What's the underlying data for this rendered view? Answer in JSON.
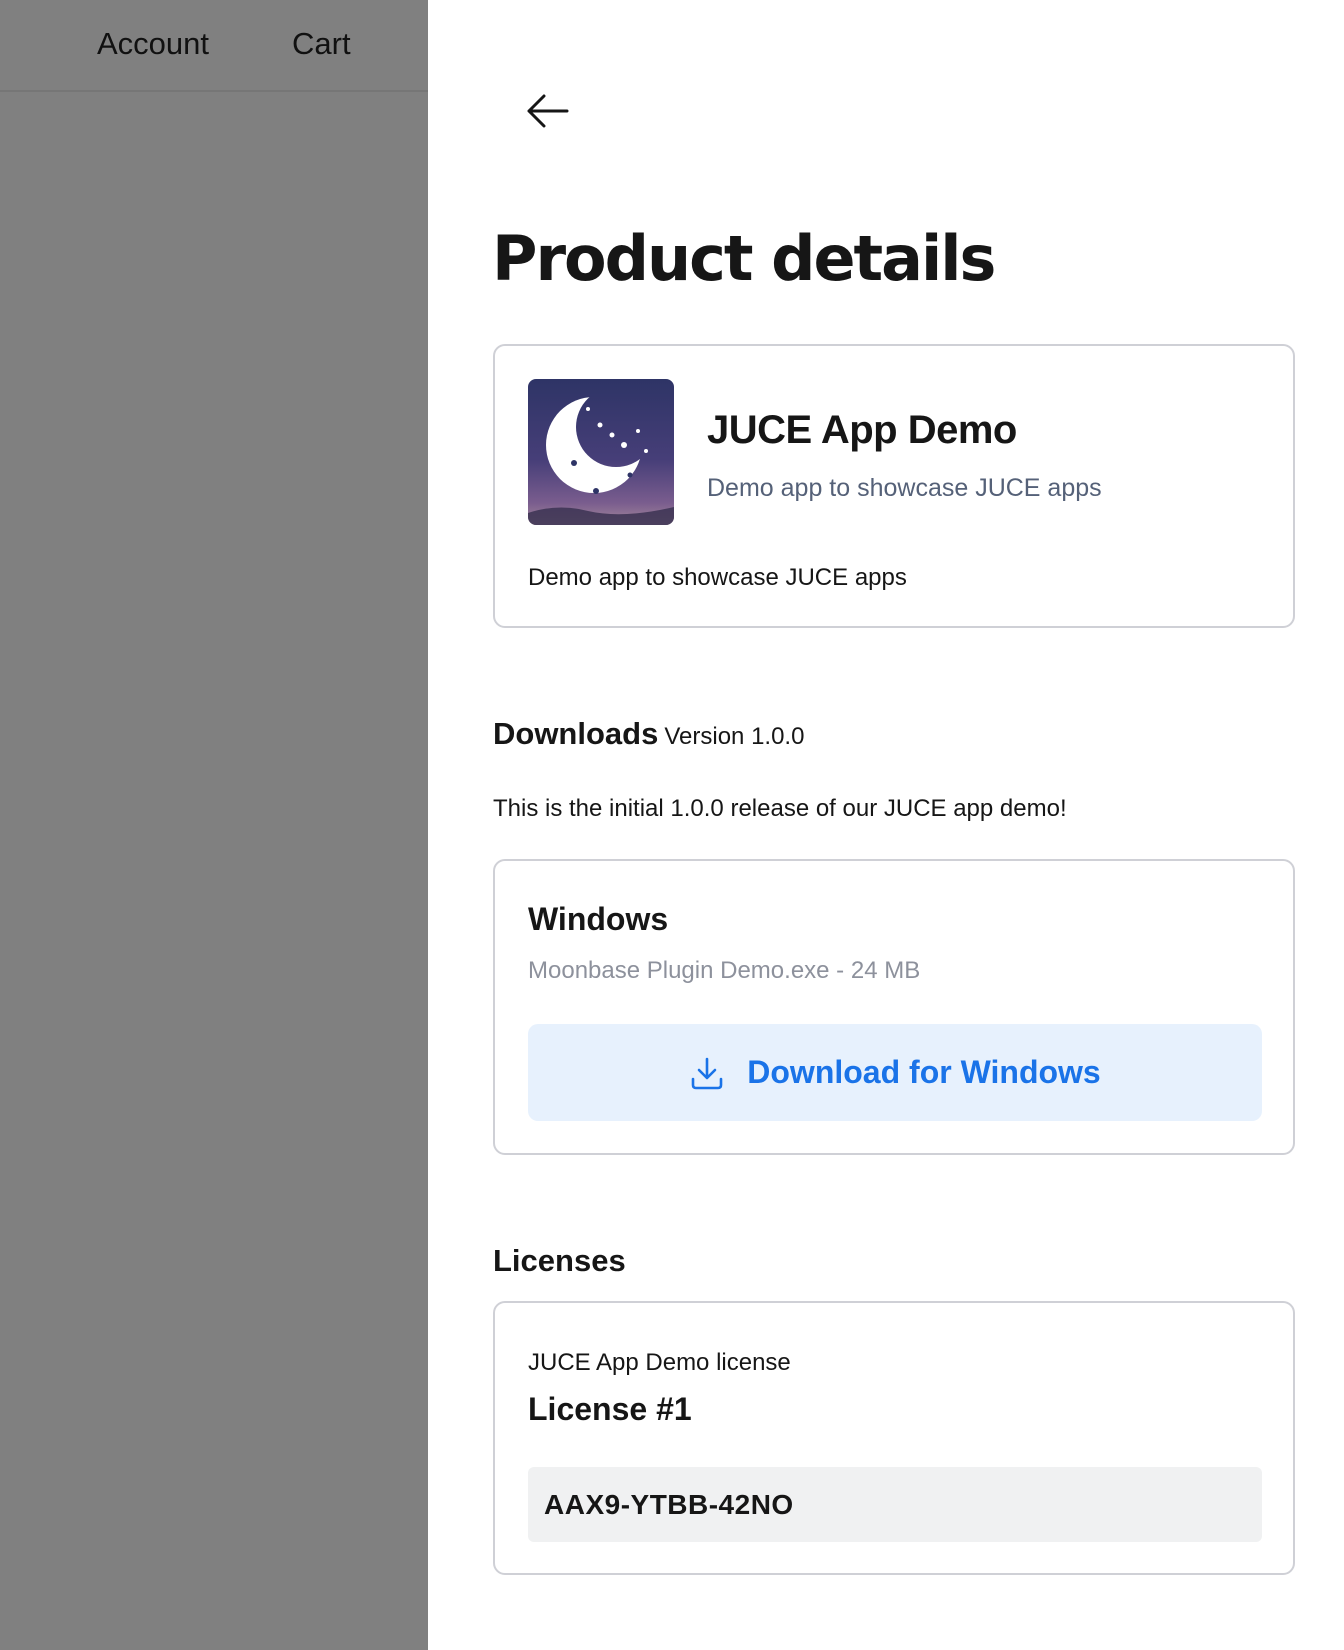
{
  "nav": {
    "account": "Account",
    "cart": "Cart"
  },
  "drawer": {
    "title": "Product details",
    "back_icon": "arrow-left-icon"
  },
  "product": {
    "icon": "crescent-moon-app-icon",
    "name": "JUCE App Demo",
    "tagline": "Demo app to showcase JUCE apps",
    "description": "Demo app to showcase JUCE apps"
  },
  "downloads": {
    "heading": "Downloads",
    "version": "Version 1.0.0",
    "release_note": "This is the initial 1.0.0 release of our JUCE app demo!",
    "items": [
      {
        "platform": "Windows",
        "file_info": "Moonbase Plugin Demo.exe - 24 MB",
        "button_label": "Download for Windows",
        "button_icon": "download-icon"
      }
    ]
  },
  "licenses": {
    "heading": "Licenses",
    "items": [
      {
        "product": "JUCE App Demo license",
        "title": "License #1",
        "key": "AAX9-YTBB-42NO"
      }
    ]
  },
  "colors": {
    "backdrop": "#808080",
    "accent": "#1a73e8",
    "button_bg": "#e7f1fd",
    "muted_text": "#8d919c",
    "tagline_text": "#556178",
    "key_bg": "#f0f1f2",
    "card_border": "#cfd0d6"
  }
}
